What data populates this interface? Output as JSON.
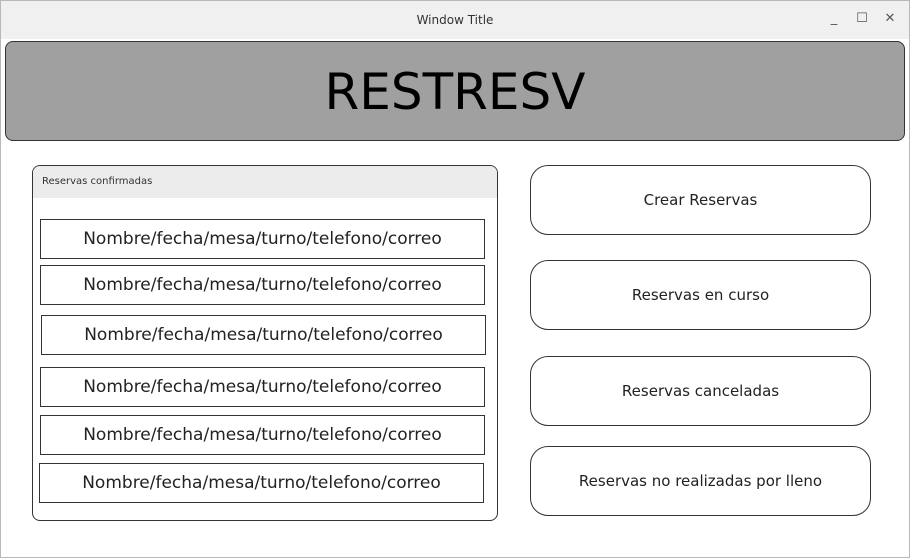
{
  "window": {
    "title": "Window Title",
    "controls": {
      "minimize": "_",
      "maximize": "☐",
      "close": "✕"
    }
  },
  "banner": {
    "title": "RESTRESV"
  },
  "confirmed_panel": {
    "title": "Reservas confirmadas",
    "rows": [
      "Nombre/fecha/mesa/turno/telefono/correo",
      "Nombre/fecha/mesa/turno/telefono/correo",
      "Nombre/fecha/mesa/turno/telefono/correo",
      "Nombre/fecha/mesa/turno/telefono/correo",
      "Nombre/fecha/mesa/turno/telefono/correo",
      "Nombre/fecha/mesa/turno/telefono/correo"
    ]
  },
  "actions": {
    "create": "Crear Reservas",
    "in_progress": "Reservas en curso",
    "cancelled": "Reservas canceladas",
    "not_done_full": "Reservas no  realizadas  por lleno"
  }
}
